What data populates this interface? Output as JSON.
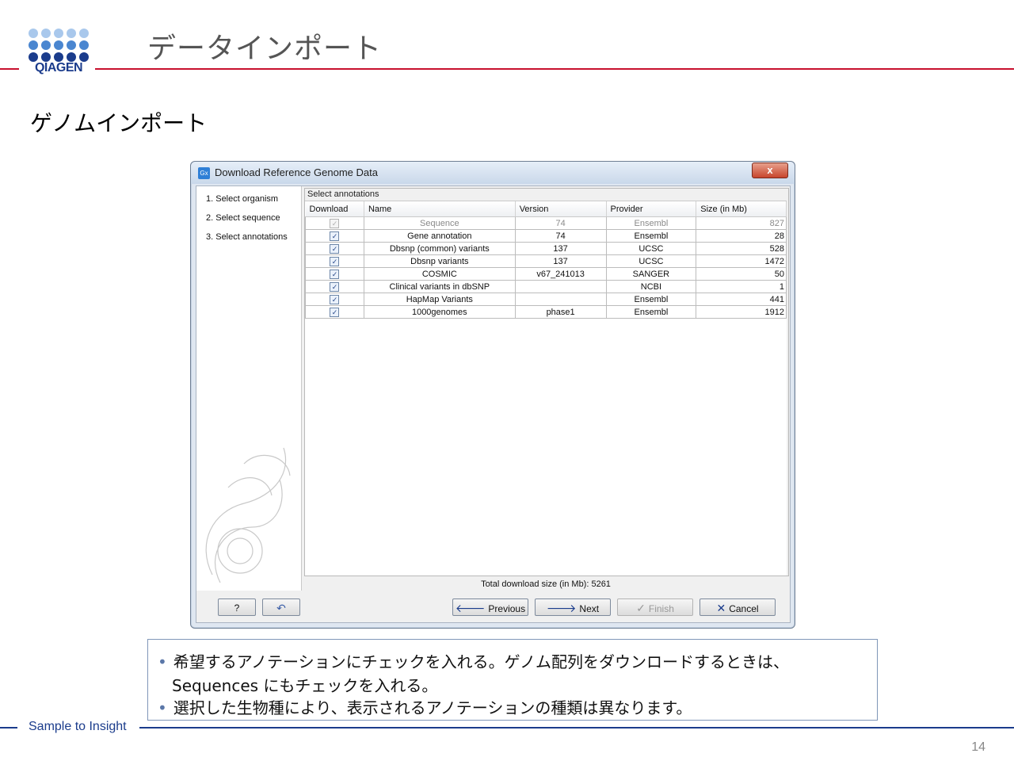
{
  "slide": {
    "brand": "QIAGEN",
    "title": "データインポート",
    "subtitle": "ゲノムインポート",
    "footer": "Sample to Insight",
    "page_number": "14",
    "colors": {
      "accent_red": "#c8102e",
      "brand_blue": "#1b3c8c",
      "logo_light": "#9fc0e8",
      "logo_mid": "#4a86d0"
    }
  },
  "dialog": {
    "title": "Download Reference Genome Data",
    "app_icon": "Gx",
    "close_label": "x",
    "steps": [
      "1. Select organism",
      "2. Select sequence",
      "3. Select annotations"
    ],
    "panel_label": "Select annotations",
    "columns": [
      "Download",
      "Name",
      "Version",
      "Provider",
      "Size (in Mb)"
    ],
    "rows": [
      {
        "checked": true,
        "enabled": false,
        "name": "Sequence",
        "version": "74",
        "provider": "Ensembl",
        "size": "827"
      },
      {
        "checked": true,
        "enabled": true,
        "name": "Gene annotation",
        "version": "74",
        "provider": "Ensembl",
        "size": "28"
      },
      {
        "checked": true,
        "enabled": true,
        "name": "Dbsnp (common) variants",
        "version": "137",
        "provider": "UCSC",
        "size": "528"
      },
      {
        "checked": true,
        "enabled": true,
        "name": "Dbsnp variants",
        "version": "137",
        "provider": "UCSC",
        "size": "1472"
      },
      {
        "checked": true,
        "enabled": true,
        "name": "COSMIC",
        "version": "v67_241013",
        "provider": "SANGER",
        "size": "50"
      },
      {
        "checked": true,
        "enabled": true,
        "name": "Clinical variants in dbSNP",
        "version": "",
        "provider": "NCBI",
        "size": "1"
      },
      {
        "checked": true,
        "enabled": true,
        "name": "HapMap Variants",
        "version": "",
        "provider": "Ensembl",
        "size": "441"
      },
      {
        "checked": true,
        "enabled": true,
        "name": "1000genomes",
        "version": "phase1",
        "provider": "Ensembl",
        "size": "1912"
      }
    ],
    "total_text": "Total download size (in Mb): 5261",
    "buttons": {
      "help": "?",
      "reset_icon": "undo-arrow-icon",
      "previous": "Previous",
      "next": "Next",
      "finish": "Finish",
      "cancel": "Cancel"
    }
  },
  "notes": {
    "line1": "希望するアノテーションにチェックを入れる。ゲノム配列をダウンロードするときは、",
    "line2": "Sequences にもチェックを入れる。",
    "line3": "選択した生物種により、表示されるアノテーションの種類は異なります。"
  }
}
